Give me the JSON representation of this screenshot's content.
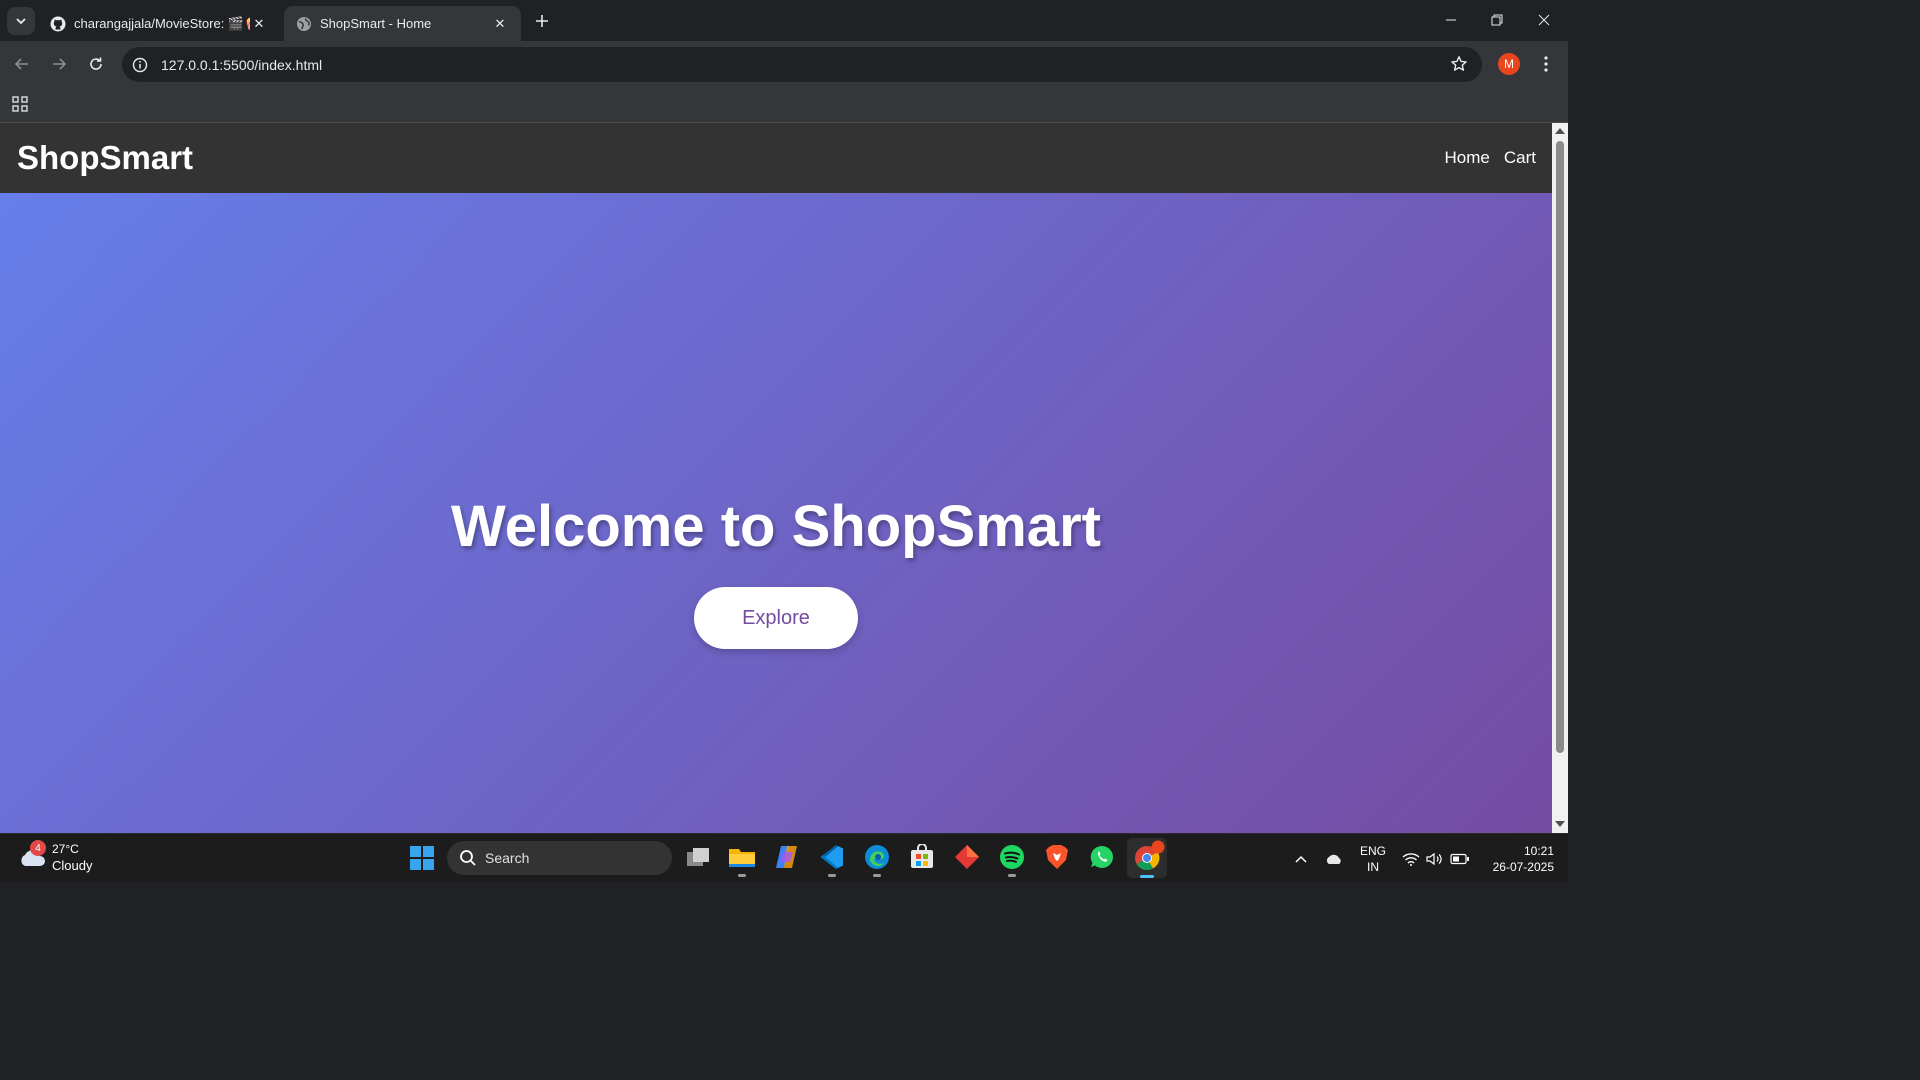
{
  "browser": {
    "tabs": [
      {
        "title": "charangajjala/MovieStore: 🎬🍿",
        "active": false,
        "icon": "github-icon"
      },
      {
        "title": "ShopSmart - Home",
        "active": true,
        "icon": "globe-icon"
      }
    ],
    "address_bar": {
      "url": "127.0.0.1:5500/index.html"
    },
    "profile_initial": "M"
  },
  "page": {
    "logo": "ShopSmart",
    "nav": {
      "home": "Home",
      "cart": "Cart"
    },
    "hero": {
      "title": "Welcome to ShopSmart",
      "button_label": "Explore"
    }
  },
  "colors": {
    "header_bg": "#333333",
    "hero_gradient_start": "#667eea",
    "hero_gradient_end": "#764ba2",
    "button_text": "#764ba2"
  },
  "taskbar": {
    "weather": {
      "badge": "4",
      "temperature": "27°C",
      "condition": "Cloudy"
    },
    "search_placeholder": "Search",
    "apps": [
      "task-view-icon",
      "file-explorer-icon",
      "copilot-icon",
      "vscode-icon",
      "edge-icon",
      "microsoft-store-icon",
      "app-diamond-icon",
      "spotify-icon",
      "brave-icon",
      "whatsapp-icon",
      "chrome-icon"
    ],
    "language": {
      "line1": "ENG",
      "line2": "IN"
    },
    "clock": {
      "time": "10:21",
      "date": "26-07-2025"
    }
  }
}
